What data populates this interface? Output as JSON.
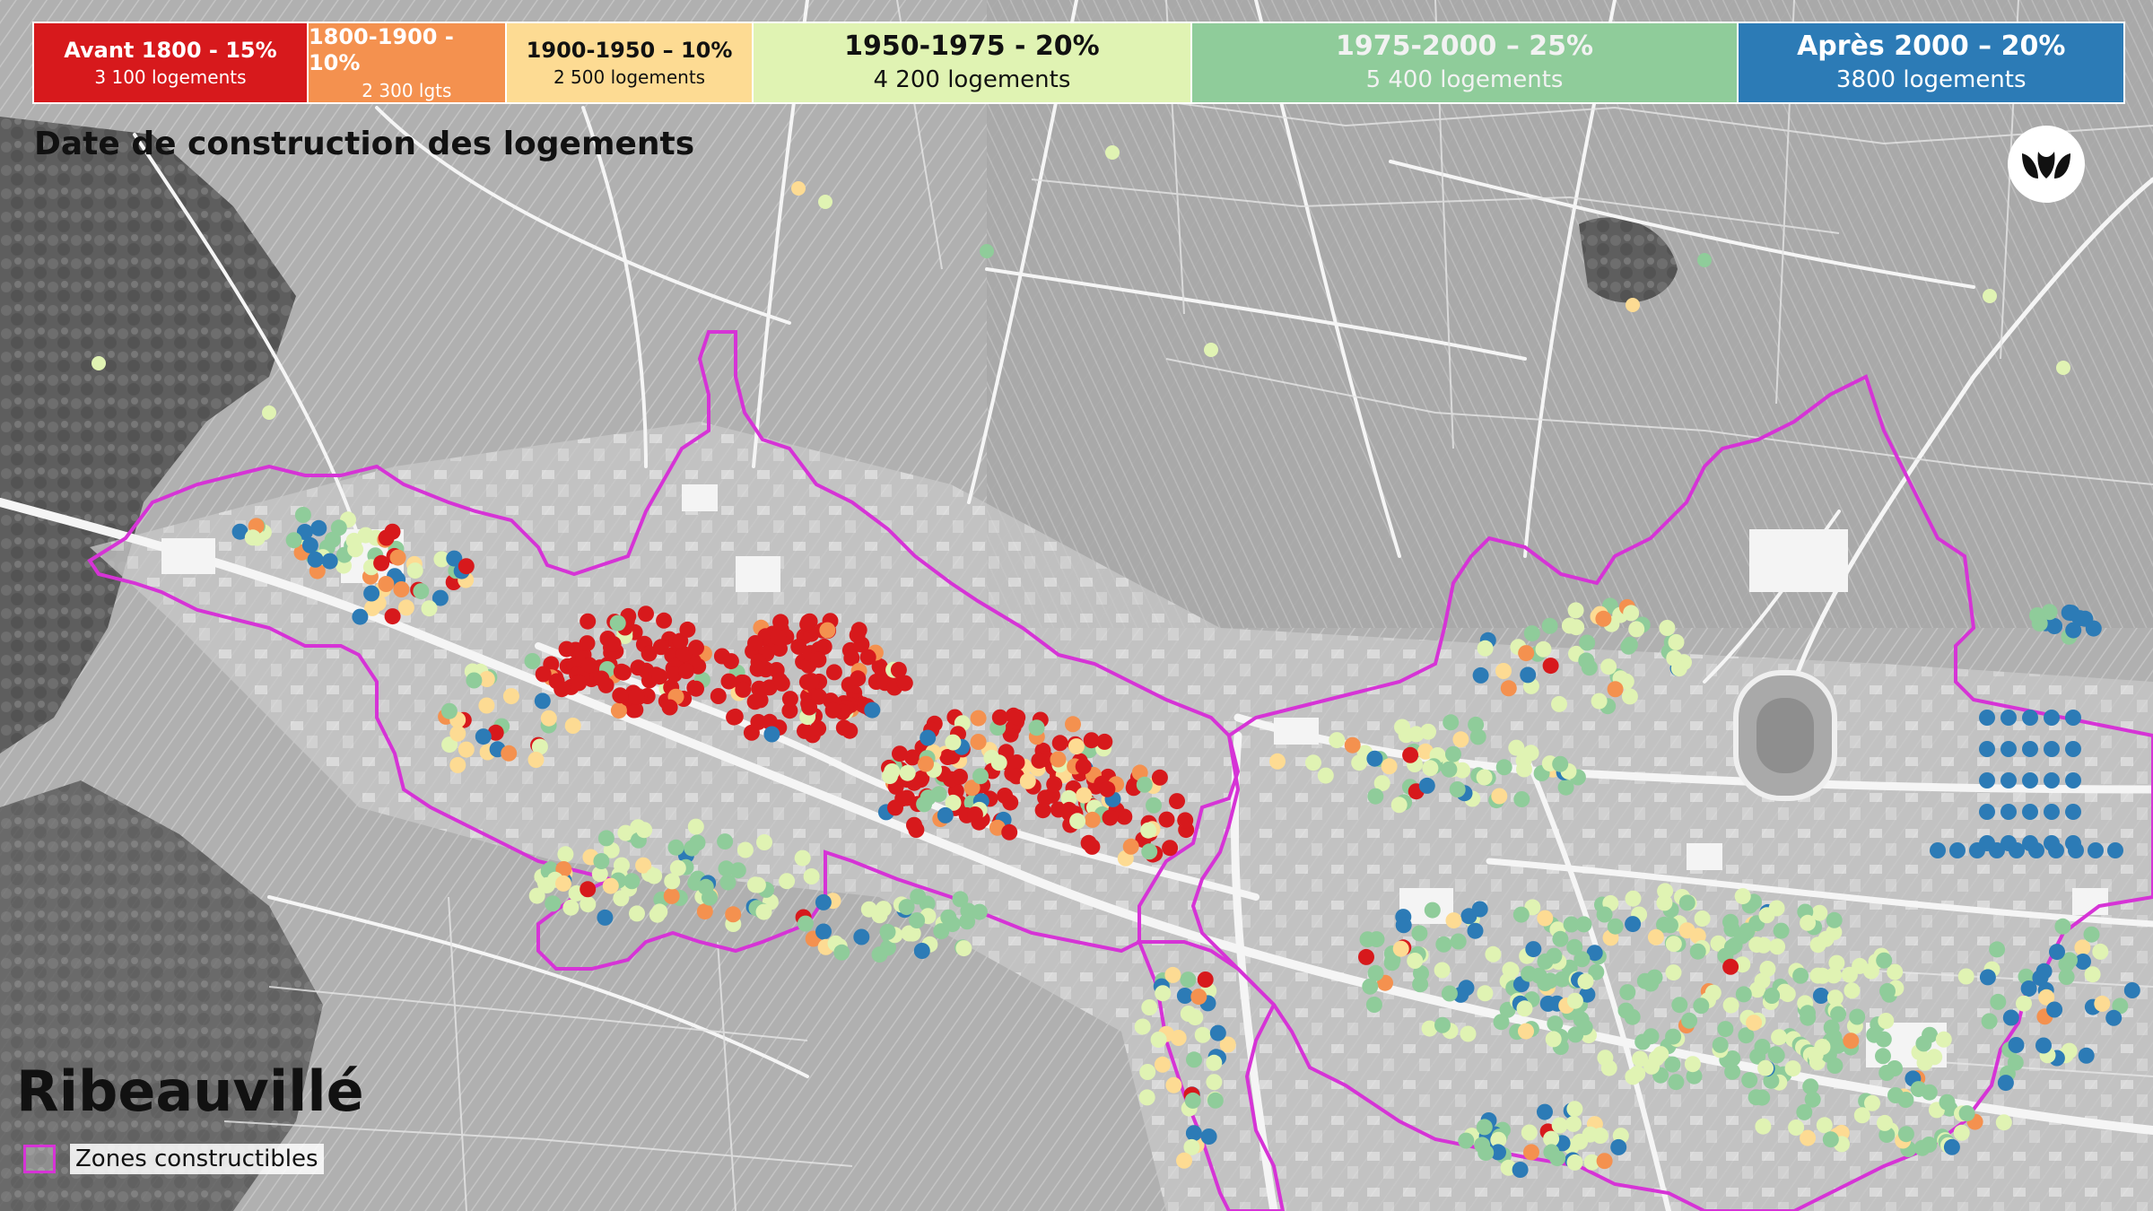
{
  "legend": [
    {
      "title": "Avant 1800 - 15%",
      "subtitle": "3 100 logements",
      "color": "#d7191c",
      "text_color": "#ffffff",
      "title_size": 24,
      "sub_size": 20,
      "weight": 1.0
    },
    {
      "title": "1800-1900 - 10%",
      "subtitle": "2 300 lgts",
      "color": "#f4914f",
      "text_color": "#ffffff",
      "title_size": 24,
      "sub_size": 20,
      "weight": 0.72
    },
    {
      "title": "1900-1950 – 10%",
      "subtitle": "2 500 logements",
      "color": "#fddb93",
      "text_color": "#111111",
      "title_size": 24,
      "sub_size": 20,
      "weight": 0.9
    },
    {
      "title": "1950-1975 - 20%",
      "subtitle": "4 200 logements",
      "color": "#e0f3b3",
      "text_color": "#111111",
      "title_size": 30,
      "sub_size": 26,
      "weight": 1.6
    },
    {
      "title": "1975-2000 – 25%",
      "subtitle": "5 400 logements",
      "color": "#8fcc9a",
      "text_color": "#f2f2f2",
      "title_size": 30,
      "sub_size": 26,
      "weight": 2.0
    },
    {
      "title": "Après 2000 – 20%",
      "subtitle": "3800 logements",
      "color": "#2c7bb6",
      "text_color": "#ffffff",
      "title_size": 30,
      "sub_size": 26,
      "weight": 1.41
    }
  ],
  "map_title": "Date de construction des logements",
  "place_name": "Ribeauvillé",
  "zone_label": "Zones constructibles",
  "zone_color": "#d633d6",
  "logo_icon": "logo-icon"
}
